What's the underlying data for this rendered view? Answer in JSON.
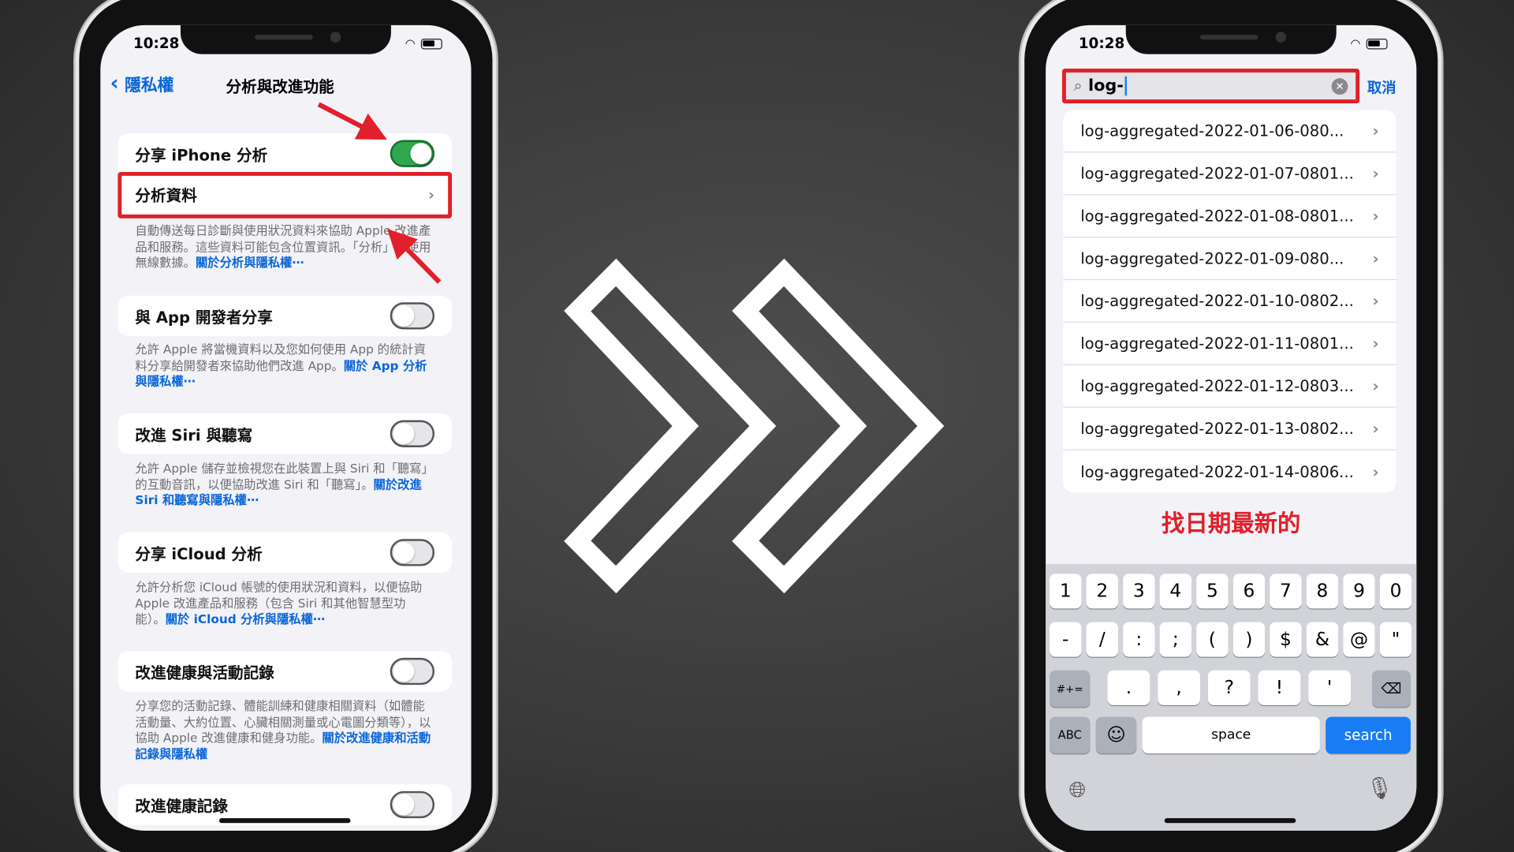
{
  "left_phone": {
    "time": "10:28",
    "back_label": "隱私權",
    "title": "分析與改進功能",
    "share_iphone": {
      "label": "分享 iPhone 分析",
      "on": true
    },
    "analytics_data": "分析資料",
    "desc1": "自動傳送每日診斷與使用狀況資料來協助 Apple 改進產品和服務。這些資料可能包含位置資訊。「分析」會使用無線數據。",
    "link1": "關於分析與隱私權⋯",
    "app_dev": {
      "label": "與 App 開發者分享",
      "on": false
    },
    "desc2": "允許 Apple 將當機資料以及您如何使用 App 的統計資料分享給開發者來協助他們改進 App。",
    "link2": "關於 App 分析與隱私權⋯",
    "siri": {
      "label": "改進 Siri 與聽寫",
      "on": false
    },
    "desc3": "允許 Apple 儲存並檢視您在此裝置上與 Siri 和「聽寫」的互動音訊，以便協助改進 Siri 和「聽寫」。",
    "link3": "關於改進 Siri 和聽寫與隱私權⋯",
    "icloud": {
      "label": "分享 iCloud 分析",
      "on": false
    },
    "desc4": "允許分析您 iCloud 帳號的使用狀況和資料，以便協助 Apple 改進產品和服務（包含 Siri 和其他智慧型功能）。",
    "link4": "關於 iCloud 分析與隱私權⋯",
    "health": {
      "label": "改進健康與活動記錄",
      "on": false
    },
    "desc5": "分享您的活動記錄、體能訓練和健康相關資料（如體能活動量、大約位置、心臟相關測量或心電圖分類等），以協助 Apple 改進健康和健身功能。",
    "link5": "關於改進健康和活動記錄與隱私權",
    "health_records": {
      "label": "改進健康記錄",
      "on": false
    }
  },
  "right_phone": {
    "time": "10:28",
    "search_value": "log-",
    "cancel_label": "取消",
    "results": [
      "log-aggregated-2022-01-06-080...",
      "log-aggregated-2022-01-07-0801...",
      "log-aggregated-2022-01-08-0801...",
      "log-aggregated-2022-01-09-080...",
      "log-aggregated-2022-01-10-0802...",
      "log-aggregated-2022-01-11-0801...",
      "log-aggregated-2022-01-12-0803...",
      "log-aggregated-2022-01-13-0802...",
      "log-aggregated-2022-01-14-0806..."
    ],
    "annotation": "找日期最新的",
    "keyboard": {
      "row1": [
        "1",
        "2",
        "3",
        "4",
        "5",
        "6",
        "7",
        "8",
        "9",
        "0"
      ],
      "row2": [
        "-",
        "/",
        ":",
        ";",
        "(",
        ")",
        "$",
        "&",
        "@",
        "\""
      ],
      "row3_toggle": "#+=",
      "row3": [
        ".",
        ",",
        "?",
        "!",
        "'"
      ],
      "abc": "ABC",
      "space": "space",
      "search": "search"
    }
  },
  "colors": {
    "highlight_red": "#e0202a",
    "toggle_on": "#2fa84f",
    "link_blue": "#0a66d8",
    "search_key": "#1a7cf5"
  }
}
